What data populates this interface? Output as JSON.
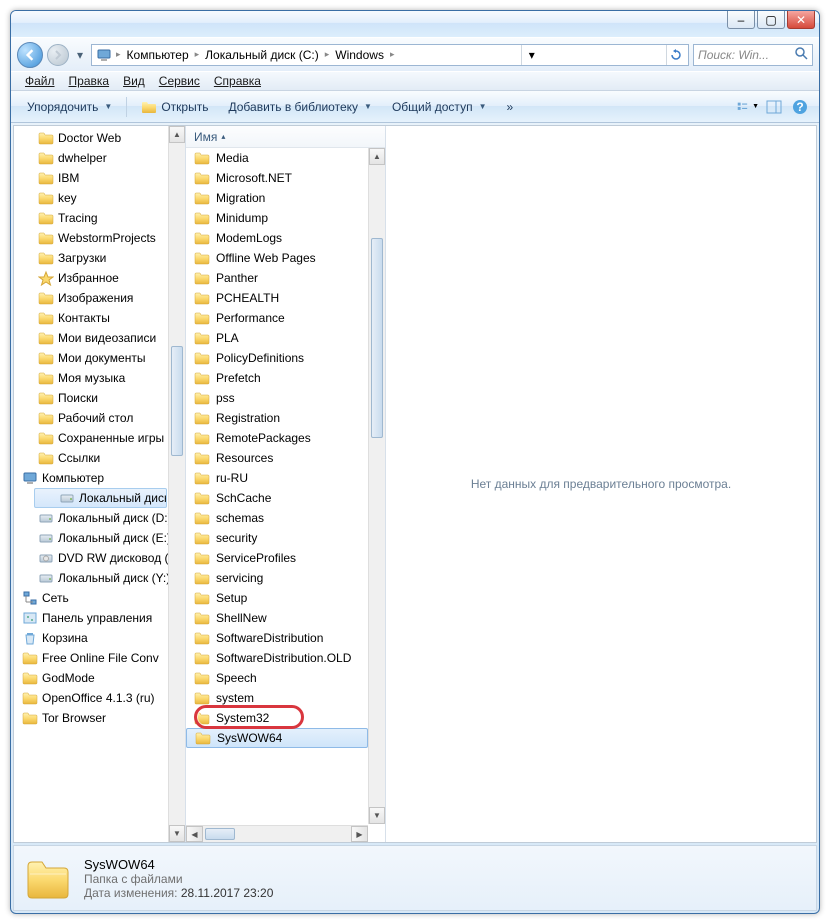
{
  "window": {
    "buttons": {
      "minimize": "–",
      "maximize": "▢",
      "close": "✕"
    }
  },
  "breadcrumb": {
    "root_icon": "computer-icon",
    "items": [
      "Компьютер",
      "Локальный диск (C:)",
      "Windows"
    ]
  },
  "search": {
    "placeholder": "Поиск: Win..."
  },
  "menubar": {
    "file": "Файл",
    "edit": "Правка",
    "view": "Вид",
    "tools": "Сервис",
    "help": "Справка"
  },
  "toolbar": {
    "organize": "Упорядочить",
    "open": "Открыть",
    "add_to_library": "Добавить в библиотеку",
    "share": "Общий доступ",
    "more": "»"
  },
  "tree": {
    "items": [
      {
        "label": "Doctor Web",
        "icon": "folder",
        "level": 1
      },
      {
        "label": "dwhelper",
        "icon": "folder",
        "level": 1
      },
      {
        "label": "IBM",
        "icon": "folder",
        "level": 1
      },
      {
        "label": "key",
        "icon": "folder",
        "level": 1
      },
      {
        "label": "Tracing",
        "icon": "folder",
        "level": 1
      },
      {
        "label": "WebstormProjects",
        "icon": "folder",
        "level": 1
      },
      {
        "label": "Загрузки",
        "icon": "folder",
        "level": 1
      },
      {
        "label": "Избранное",
        "icon": "star",
        "level": 1
      },
      {
        "label": "Изображения",
        "icon": "pictures",
        "level": 1
      },
      {
        "label": "Контакты",
        "icon": "contacts",
        "level": 1
      },
      {
        "label": "Мои видеозаписи",
        "icon": "video",
        "level": 1
      },
      {
        "label": "Мои документы",
        "icon": "documents",
        "level": 1
      },
      {
        "label": "Моя музыка",
        "icon": "music",
        "level": 1
      },
      {
        "label": "Поиски",
        "icon": "search-folder",
        "level": 1
      },
      {
        "label": "Рабочий стол",
        "icon": "desktop",
        "level": 1
      },
      {
        "label": "Сохраненные игры",
        "icon": "games",
        "level": 1
      },
      {
        "label": "Ссылки",
        "icon": "links",
        "level": 1
      },
      {
        "label": "Компьютер",
        "icon": "computer",
        "level": 0
      },
      {
        "label": "Локальный диск (C:)",
        "icon": "drive",
        "level": 1,
        "selected": true
      },
      {
        "label": "Локальный диск (D:)",
        "icon": "drive",
        "level": 1
      },
      {
        "label": "Локальный диск (E:)",
        "icon": "drive",
        "level": 1
      },
      {
        "label": "DVD RW дисковод (F:)",
        "icon": "dvd",
        "level": 1
      },
      {
        "label": "Локальный диск (Y:)",
        "icon": "drive",
        "level": 1
      },
      {
        "label": "Сеть",
        "icon": "network",
        "level": 0
      },
      {
        "label": "Панель управления",
        "icon": "control-panel",
        "level": 0
      },
      {
        "label": "Корзина",
        "icon": "recycle-bin",
        "level": 0
      },
      {
        "label": "Free Online File Conv",
        "icon": "folder",
        "level": 0
      },
      {
        "label": "GodMode",
        "icon": "folder",
        "level": 0
      },
      {
        "label": "OpenOffice 4.1.3 (ru)",
        "icon": "folder",
        "level": 0
      },
      {
        "label": "Tor Browser",
        "icon": "folder",
        "level": 0
      }
    ]
  },
  "filelist": {
    "column_name": "Имя",
    "items": [
      "Media",
      "Microsoft.NET",
      "Migration",
      "Minidump",
      "ModemLogs",
      "Offline Web Pages",
      "Panther",
      "PCHEALTH",
      "Performance",
      "PLA",
      "PolicyDefinitions",
      "Prefetch",
      "pss",
      "Registration",
      "RemotePackages",
      "Resources",
      "ru-RU",
      "SchCache",
      "schemas",
      "security",
      "ServiceProfiles",
      "servicing",
      "Setup",
      "ShellNew",
      "SoftwareDistribution",
      "SoftwareDistribution.OLD",
      "Speech",
      "system",
      "System32",
      "SysWOW64"
    ],
    "highlighted_index": 28,
    "selected_index": 29
  },
  "preview": {
    "empty_text": "Нет данных для предварительного просмотра."
  },
  "statusbar": {
    "name": "SysWOW64",
    "type": "Папка с файлами",
    "date_label": "Дата изменения:",
    "date_value": "28.11.2017 23:20"
  }
}
